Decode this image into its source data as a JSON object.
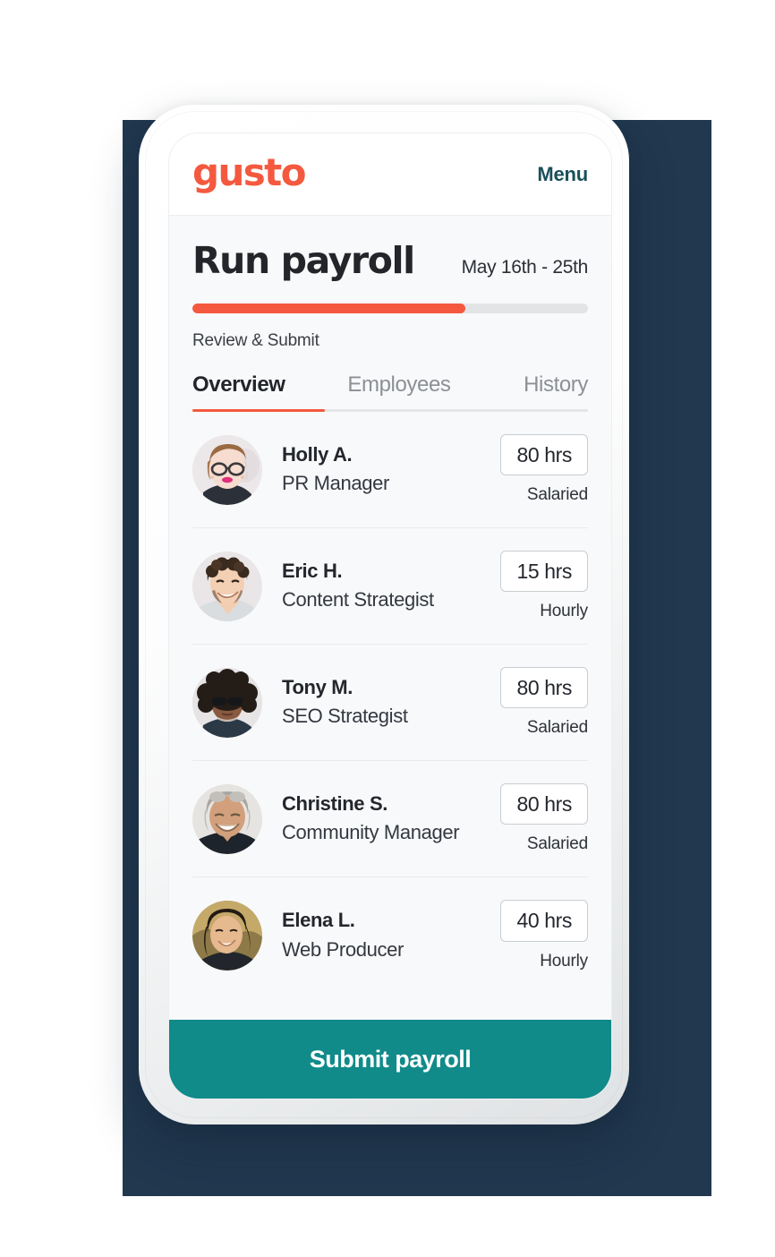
{
  "app": {
    "logo_text": "gusto",
    "menu_label": "Menu",
    "brand_coral": "#F4593F",
    "brand_teal": "#118A8A",
    "menu_teal": "#1A5059",
    "backdrop_navy": "#21384F"
  },
  "header": {
    "title": "Run payroll",
    "date_range": "May 16th - 25th",
    "progress_percent": 69,
    "progress_label": "Review & Submit"
  },
  "tabs": [
    {
      "label": "Overview",
      "active": true
    },
    {
      "label": "Employees",
      "active": false
    },
    {
      "label": "History",
      "active": false
    }
  ],
  "employees": [
    {
      "name": "Holly A.",
      "role": "PR Manager",
      "hours": "80 hrs",
      "pay_type": "Salaried",
      "avatar": "avatar-holly"
    },
    {
      "name": "Eric H.",
      "role": "Content Strategist",
      "hours": "15 hrs",
      "pay_type": "Hourly",
      "avatar": "avatar-eric"
    },
    {
      "name": "Tony M.",
      "role": "SEO Strategist",
      "hours": "80 hrs",
      "pay_type": "Salaried",
      "avatar": "avatar-tony"
    },
    {
      "name": "Christine S.",
      "role": "Community Manager",
      "hours": "80 hrs",
      "pay_type": "Salaried",
      "avatar": "avatar-christine"
    },
    {
      "name": "Elena L.",
      "role": "Web Producer",
      "hours": "40 hrs",
      "pay_type": "Hourly",
      "avatar": "avatar-elena"
    }
  ],
  "footer": {
    "submit_label": "Submit payroll"
  }
}
